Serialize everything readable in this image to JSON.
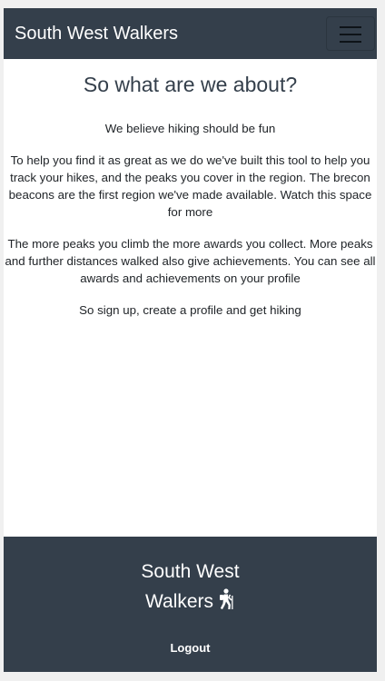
{
  "navbar": {
    "brand": "South West Walkers",
    "toggle_icon": "hamburger-menu-icon"
  },
  "main": {
    "heading": "So what are we about?",
    "paragraphs": [
      "We believe hiking should be fun",
      "To help you find it as great as we do we've built this tool to help you track your hikes, and the peaks you cover in the region. The brecon beacons are the first region we've made available. Watch this space for more",
      "The more peaks you climb the more awards you collect. More peaks and further distances walked also give achievements. You can see all awards and achievements on your profile",
      "So sign up, create a profile and get hiking"
    ]
  },
  "footer": {
    "title_line1": "South West",
    "title_line2": "Walkers",
    "icon": "hiker-icon",
    "logout_label": "Logout"
  },
  "colors": {
    "navbar_bg": "#343f4b",
    "footer_bg": "#343f4b",
    "heading": "#343f4b",
    "text": "#212529"
  }
}
